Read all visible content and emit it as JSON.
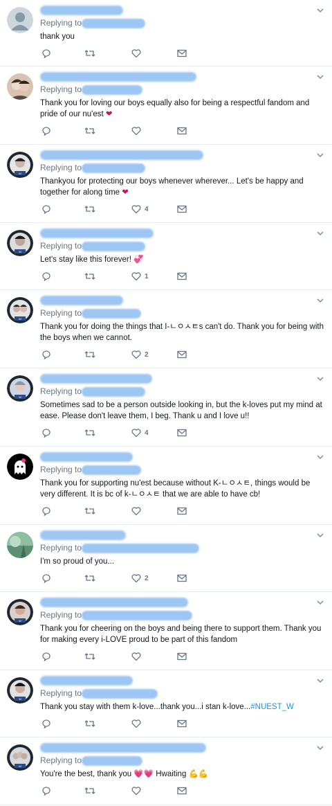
{
  "icons": {
    "reply": "reply-icon",
    "retweet": "retweet-icon",
    "like": "heart-icon",
    "dm": "envelope-icon",
    "more": "chevron-down-icon"
  },
  "colors": {
    "muted": "#657786",
    "redaction": "#9ec6f3",
    "hashtag": "#1b95e0",
    "divider": "#e6ecf0"
  },
  "tweets": [
    {
      "replying_label": "Replying to",
      "text": "thank you",
      "likes": ""
    },
    {
      "replying_label": "Replying to",
      "text": "Thank you for loving our boys equally also for being a respectful fandom and pride of our nu'est",
      "emoji": "❤",
      "likes": ""
    },
    {
      "replying_label": "Replying to",
      "text": "Thankyou for protecting our boys whenever wherever... Let's be happy and together for along time",
      "emoji": "❤",
      "likes": "4"
    },
    {
      "replying_label": "Replying to",
      "text": "Let's stay like this forever!",
      "emoji": "💞",
      "likes": "1"
    },
    {
      "replying_label": "Replying to",
      "text": "Thank you for doing the things that I-ㄴㅇㅅㅌs can't do. Thank you for being with the boys when we cannot.",
      "likes": "2"
    },
    {
      "replying_label": "Replying to",
      "text": "Sometimes sad to be a person outside looking in, but the k-loves put my mind at ease. Please don't leave them, I beg. Thank u and I love u!!",
      "likes": "4"
    },
    {
      "replying_label": "Replying to",
      "text": "Thank you for supporting nu'est because without  K-ㄴㅇㅅㅌ, things would be very different. It is bc of k-ㄴㅇㅅㅌ that we are able to have cb!",
      "likes": ""
    },
    {
      "replying_label": "Replying to",
      "text": "I'm so proud of you...",
      "likes": "2"
    },
    {
      "replying_label": "Replying to",
      "text": "Thank you for cheering on the boys and being there to support them. Thank you for making every i-LOVE proud to be part of this fandom",
      "likes": ""
    },
    {
      "replying_label": "Replying to",
      "text": "Thank you stay with them k-love...thank you...i stan k-love...",
      "hashtag": "#NUEST_W",
      "likes": ""
    },
    {
      "replying_label": "Replying to",
      "text": "You're the best, thank you",
      "emoji": "💗💗",
      "text_after": "Hwaiting",
      "emoji_after": "💪💪",
      "likes": ""
    }
  ]
}
